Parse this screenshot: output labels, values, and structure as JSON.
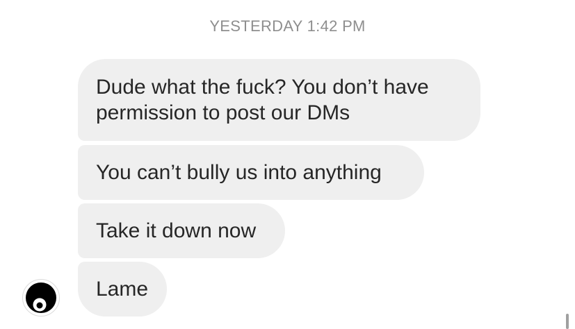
{
  "conversation": {
    "timestamp": "YESTERDAY 1:42 PM",
    "messages": [
      {
        "text": "Dude what the fuck? You don’t have permission to post our DMs"
      },
      {
        "text": "You can’t bully us into anything"
      },
      {
        "text": "Take it down now"
      },
      {
        "text": "Lame"
      }
    ]
  },
  "sender": {
    "avatar_icon": "profile-avatar-icon"
  },
  "colors": {
    "bubble_bg": "#efefef",
    "message_text": "#262626",
    "timestamp_text": "#8e8e8e",
    "background": "#ffffff"
  }
}
